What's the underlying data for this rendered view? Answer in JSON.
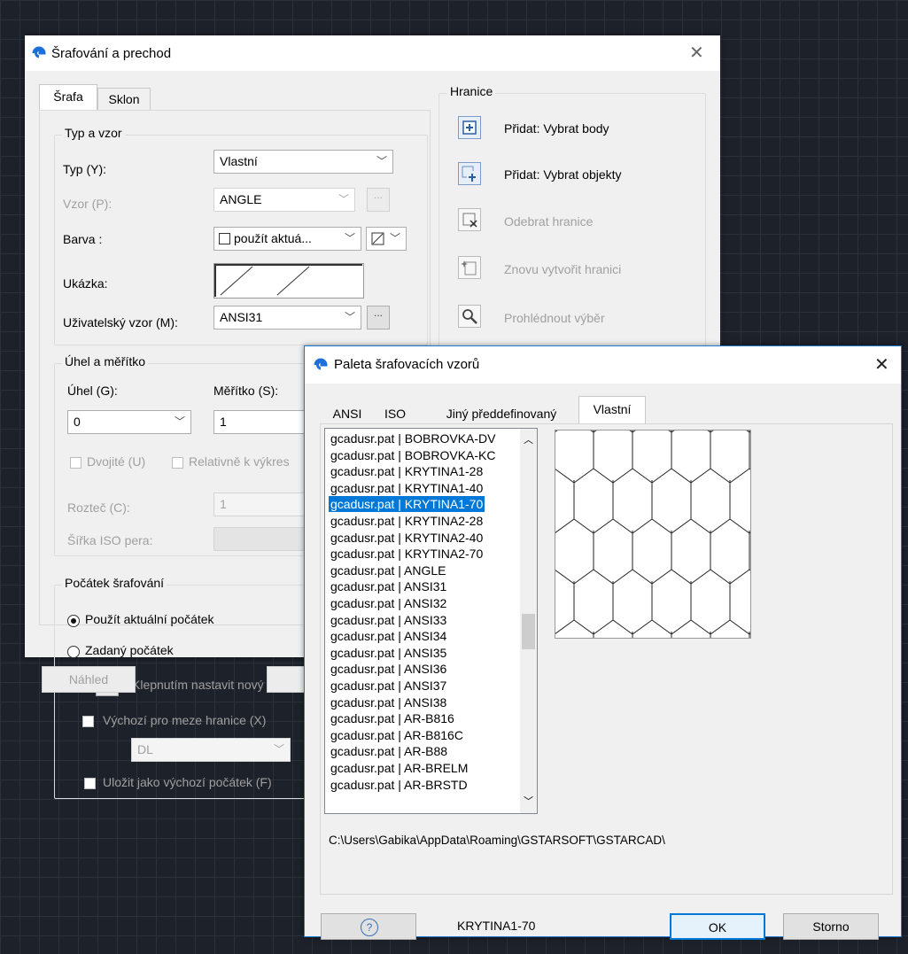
{
  "hatch_dialog": {
    "title": "Šrafování a prechod",
    "tabs": [
      "Šrafa",
      "Sklon"
    ],
    "type_pattern": {
      "group_label": "Typ a vzor",
      "type_label": "Typ (Y):",
      "type_value": "Vlastní",
      "pattern_label": "Vzor (P):",
      "pattern_value": "ANGLE",
      "pattern_btn": "...",
      "color_label": "Barva :",
      "color_value": "použít aktuá...",
      "swatch_label": "Ukázka:",
      "custom_label": "Uživatelský vzor (M):",
      "custom_value": "ANSI31",
      "custom_btn": "..."
    },
    "angle_scale": {
      "group_label": "Úhel a měřítko",
      "angle_label": "Úhel (G):",
      "angle_value": "0",
      "scale_label": "Měřítko (S):",
      "scale_value": "1",
      "double_label": "Dvojité (U)",
      "relative_label": "Relativně k výkres",
      "spacing_label": "Rozteč (C):",
      "spacing_value": "1",
      "iso_label": "Šířka ISO pera:"
    },
    "origin": {
      "group_label": "Počátek šrafování",
      "use_current_label": "Použít aktuální počátek",
      "specified_label": "Zadaný počátek",
      "click_label": "Klepnutím nastavit nový po",
      "default_extent_label": "Výchozí pro meze hranice (X)",
      "extent_value": "DL",
      "store_label": "Uložit jako výchozí počátek (F)"
    },
    "boundaries": {
      "group_label": "Hranice",
      "items": [
        {
          "label": "Přidat: Vybrat body",
          "icon": "add-pick-points-icon",
          "enabled": true
        },
        {
          "label": "Přidat: Vybrat objekty",
          "icon": "add-select-objects-icon",
          "enabled": true
        },
        {
          "label": "Odebrat hranice",
          "icon": "remove-boundaries-icon",
          "enabled": false
        },
        {
          "label": "Znovu vytvořit hranici",
          "icon": "recreate-boundary-icon",
          "enabled": false
        },
        {
          "label": "Prohlédnout výběr",
          "icon": "view-selections-icon",
          "enabled": false
        }
      ]
    },
    "preview_btn": "Náhled"
  },
  "palette_dialog": {
    "title": "Paleta šrafovacích vzorů",
    "tabs": [
      "ANSI",
      "ISO",
      "Jiný předdefinovaný",
      "Vlastní"
    ],
    "active_tab": "Vlastní",
    "patterns": [
      "gcadusr.pat | BOBROVKA-DV",
      "gcadusr.pat | BOBROVKA-KC",
      "gcadusr.pat | KRYTINA1-28",
      "gcadusr.pat | KRYTINA1-40",
      "gcadusr.pat | KRYTINA1-70",
      "gcadusr.pat | KRYTINA2-28",
      "gcadusr.pat | KRYTINA2-40",
      "gcadusr.pat | KRYTINA2-70",
      "gcadusr.pat | ANGLE",
      "gcadusr.pat | ANSI31",
      "gcadusr.pat | ANSI32",
      "gcadusr.pat | ANSI33",
      "gcadusr.pat | ANSI34",
      "gcadusr.pat | ANSI35",
      "gcadusr.pat | ANSI36",
      "gcadusr.pat | ANSI37",
      "gcadusr.pat | ANSI38",
      "gcadusr.pat | AR-B816",
      "gcadusr.pat | AR-B816C",
      "gcadusr.pat | AR-B88",
      "gcadusr.pat | AR-BRELM",
      "gcadusr.pat | AR-BRSTD"
    ],
    "selected_index": 4,
    "path": "C:\\Users\\Gabika\\AppData\\Roaming\\GSTARSOFT\\GSTARCAD\\",
    "selected_name": "KRYTINA1-70",
    "help_btn": "?",
    "ok_btn": "OK",
    "cancel_btn": "Storno"
  }
}
